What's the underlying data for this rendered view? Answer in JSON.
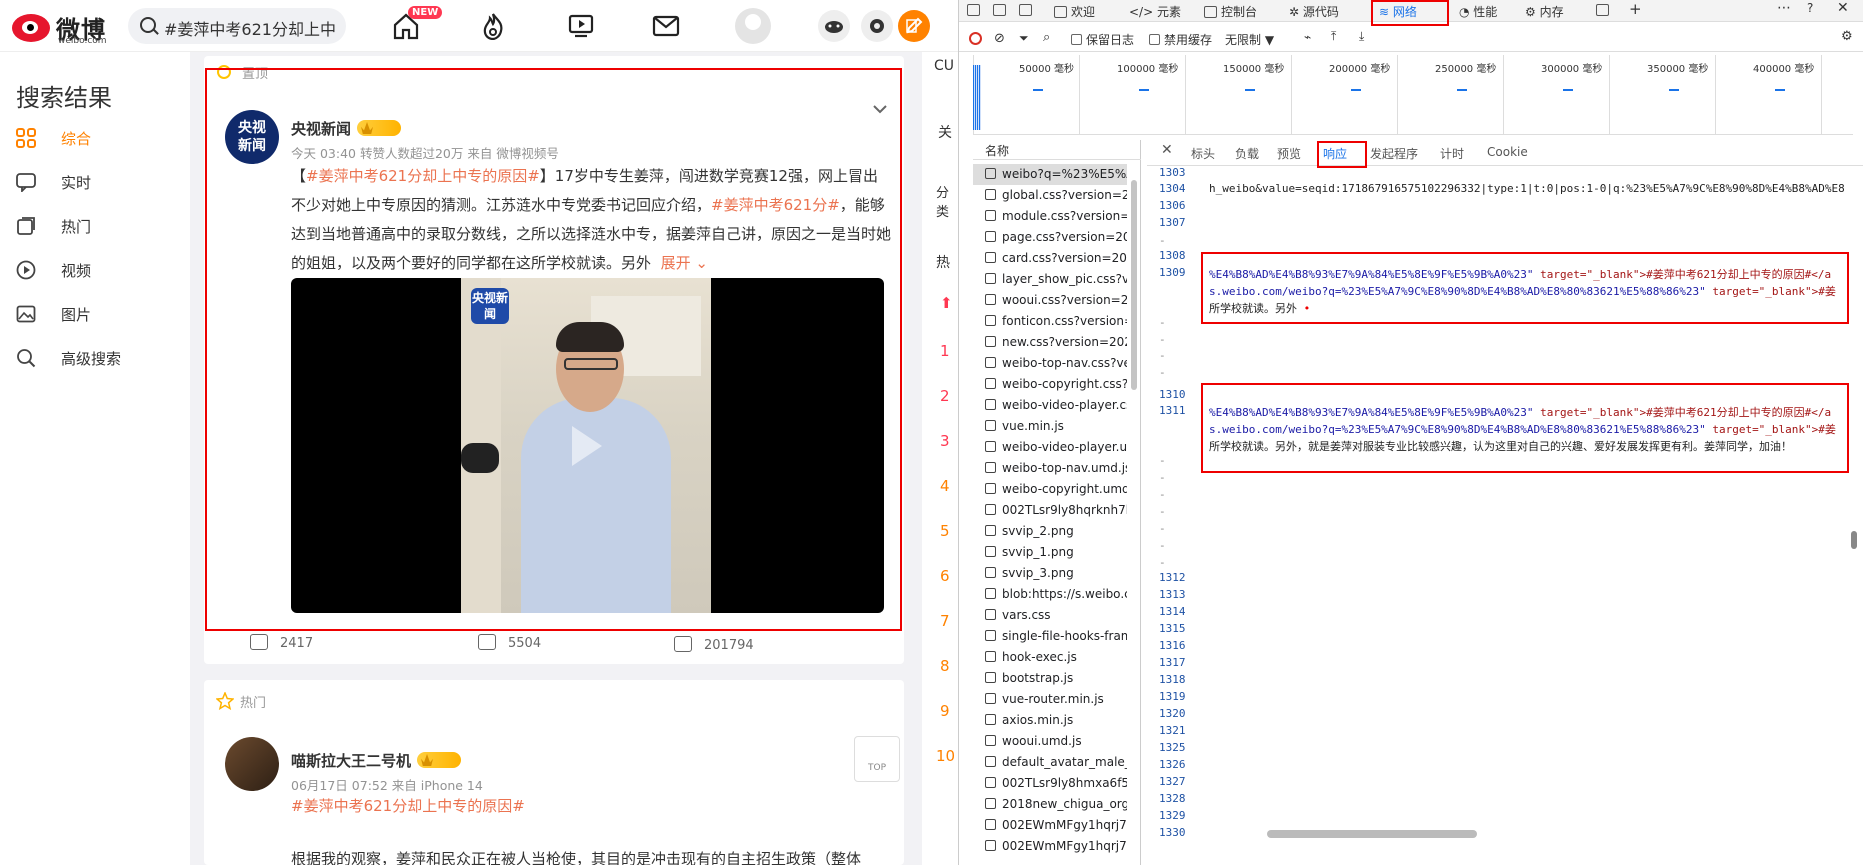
{
  "weibo": {
    "logo_text": "微博",
    "logo_sub": "weibo.com",
    "search_query": "#姜萍中考621分却上中",
    "new_badge": "NEW",
    "sidebar_title": "搜索结果",
    "sidebar_items": [
      {
        "label": "综合",
        "icon": "grid-icon"
      },
      {
        "label": "实时",
        "icon": "chat-icon"
      },
      {
        "label": "热门",
        "icon": "hot-icon"
      },
      {
        "label": "视频",
        "icon": "play-circle-icon"
      },
      {
        "label": "图片",
        "icon": "image-icon"
      },
      {
        "label": "高级搜索",
        "icon": "search-icon"
      }
    ],
    "post1": {
      "tag": "置顶",
      "author": "央视新闻",
      "meta": "今天 03:40  转赞人数超过20万  来自 微博视频号",
      "text_1": "【",
      "hashtag_1": "#姜萍中考621分却上中专的原因#",
      "text_2": "】17岁中专生姜萍，闯进数学竞赛12强，网上冒出不少对她上中专原因的猜测。江苏涟水中专党委书记回应介绍，",
      "hashtag_2": "#姜萍中考621分#",
      "text_3": "，能够达到当地普通高中的录取分数线，之所以选择涟水中专，据姜萍自己讲，原因之一是当时她的姐姐，以及两个要好的同学都在这所学校就读。另外",
      "expand": "展开",
      "video_logo": "央视新闻",
      "reposts": "2417",
      "comments": "5504",
      "likes": "201794"
    },
    "post2": {
      "tag": "热门",
      "author": "喵斯拉大王二号机",
      "meta": "06月17日 07:52  来自 iPhone 14",
      "hashtag": "#姜萍中考621分却上中专的原因#",
      "text": "根据我的观察，姜萍和民众正在被人当枪使，其目的是冲击现有的自主招生政策（整体"
    },
    "top_button": "TOP",
    "hot_numbers": [
      "1",
      "2",
      "3",
      "4",
      "5",
      "6",
      "7",
      "8",
      "9",
      "10"
    ],
    "hot_side_labels": [
      "CU",
      "关",
      "分类",
      "热"
    ]
  },
  "devtools": {
    "tabs": [
      "欢迎",
      "元素",
      "控制台",
      "源代码",
      "网络",
      "性能",
      "内存"
    ],
    "active_tab": "网络",
    "toolbar": {
      "preserve_log": "保留日志",
      "disable_cache": "禁用缓存",
      "throttle": "无限制"
    },
    "ticks": [
      "50000 毫秒",
      "100000 毫秒",
      "150000 毫秒",
      "200000 毫秒",
      "250000 毫秒",
      "300000 毫秒",
      "350000 毫秒",
      "400000 毫秒"
    ],
    "name_header": "名称",
    "requests": [
      "weibo?q=%23%E5%A7%9C...",
      "global.css?version=202406...",
      "module.css?version=20240...",
      "page.css?version=2024061...",
      "card.css?version=20240611...",
      "layer_show_pic.css?version...",
      "wooui.css?version=202406...",
      "fonticon.css?version=20240...",
      "new.css?version=20240611...",
      "weibo-top-nav.css?version...",
      "weibo-copyright.css?versio...",
      "weibo-video-player.css?ver...",
      "vue.min.js",
      "weibo-video-player.umd.js?...",
      "weibo-top-nav.umd.js?versi...",
      "weibo-copyright.umd.js?ver...",
      "002TLsr9ly8hqrknh7h54j60...",
      "svvip_2.png",
      "svvip_1.png",
      "svvip_3.png",
      "blob:https://s.weibo.com/d...",
      "vars.css",
      "single-file-hooks-frames.js",
      "hook-exec.js",
      "bootstrap.js",
      "vue-router.min.js",
      "axios.min.js",
      "wooui.umd.js",
      "default_avatar_male_180.gif...",
      "002TLsr9ly8hmxa6f543uj60...",
      "2018new_chigua_org.png",
      "002EWmMFgy1hqrj7g9vyqj...",
      "002EWmMFgy1hqrj7oxblmi..."
    ],
    "detail_tabs": [
      "标头",
      "负载",
      "预览",
      "响应",
      "发起程序",
      "计时",
      "Cookie"
    ],
    "active_detail_tab": "响应",
    "code": {
      "l1303": "1303",
      "l1304": "1304",
      "l1304_text": "h_weibo&value=seqid:171867916575102296332|type:1|t:0|pos:1-0|q:%23%E5%A7%9C%E8%90%8D%E4%B8%AD%E8",
      "l1306": "1306",
      "l1307": "1307",
      "l1308": "1308",
      "l1309": "1309",
      "l1309_a": "%E4%B8%AD%E4%B8%93%E7%9A%84%E5%8E%9F%E5%9B%A0%23\"",
      "l1309_b": "target=\"_blank\">#姜萍中考621分却上中专的原因#</a",
      "l1309_c": "s.weibo.com/weibo?q=%23%E5%A7%9C%E8%90%8D%E4%B8%AD%E8%80%83621%E5%88%86%23\"",
      "l1309_d": "target=\"_blank\">#姜",
      "l1309_e": "所学校就读。另外",
      "l1310": "1310",
      "l1311": "1311",
      "l1311_a": "%E4%B8%AD%E4%B8%93%E7%9A%84%E5%8E%9F%E5%9B%A0%23\"",
      "l1311_b": "target=\"_blank\">#姜萍中考621分却上中专的原因#</a",
      "l1311_c": "s.weibo.com/weibo?q=%23%E5%A7%9C%E8%90%8D%E4%B8%AD%E8%80%83621%E5%88%86%23\"",
      "l1311_d": "target=\"_blank\">#姜",
      "l1311_e": "所学校就读。另外，就是姜萍对服装专业比较感兴趣，认为这里对自己的兴趣、爱好发展发挥更有利。姜萍同学，加油！",
      "tail_numbers": [
        "1312",
        "1313",
        "1314",
        "1315",
        "1316",
        "1317",
        "1318",
        "1319",
        "1320",
        "1321",
        "1325",
        "1326",
        "1327",
        "1328",
        "1329",
        "1330"
      ]
    }
  }
}
